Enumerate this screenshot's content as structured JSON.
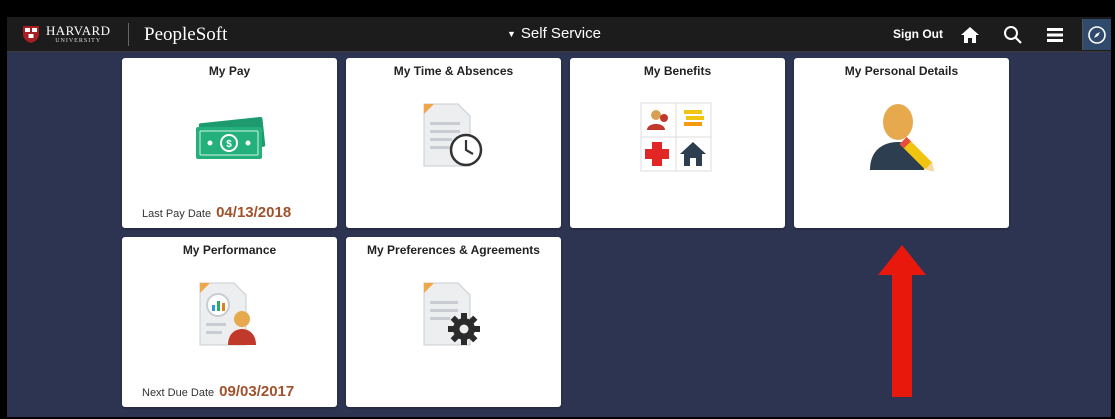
{
  "header": {
    "logo_main": "HARVARD",
    "logo_sub": "UNIVERSITY",
    "product": "PeopleSoft",
    "nav_title": "Self Service",
    "sign_out": "Sign Out",
    "icons": [
      "home-icon",
      "search-icon",
      "menu-icon",
      "navbar-compass-icon"
    ]
  },
  "tiles": [
    {
      "title": "My Pay",
      "footer_label": "Last Pay Date",
      "footer_value": "04/13/2018",
      "icon": "money-icon"
    },
    {
      "title": "My Time & Absences",
      "icon": "timesheet-icon"
    },
    {
      "title": "My Benefits",
      "icon": "benefits-icon"
    },
    {
      "title": "My Personal Details",
      "icon": "person-edit-icon"
    },
    {
      "title": "My Performance",
      "footer_label": "Next Due Date",
      "footer_value": "09/03/2017",
      "icon": "performance-icon"
    },
    {
      "title": "My Preferences & Agreements",
      "icon": "preferences-icon"
    }
  ],
  "colors": {
    "background": "#2d3451",
    "header": "#1c1c1c",
    "accent_date": "#a0522d",
    "annotation_arrow": "#e8180c"
  }
}
